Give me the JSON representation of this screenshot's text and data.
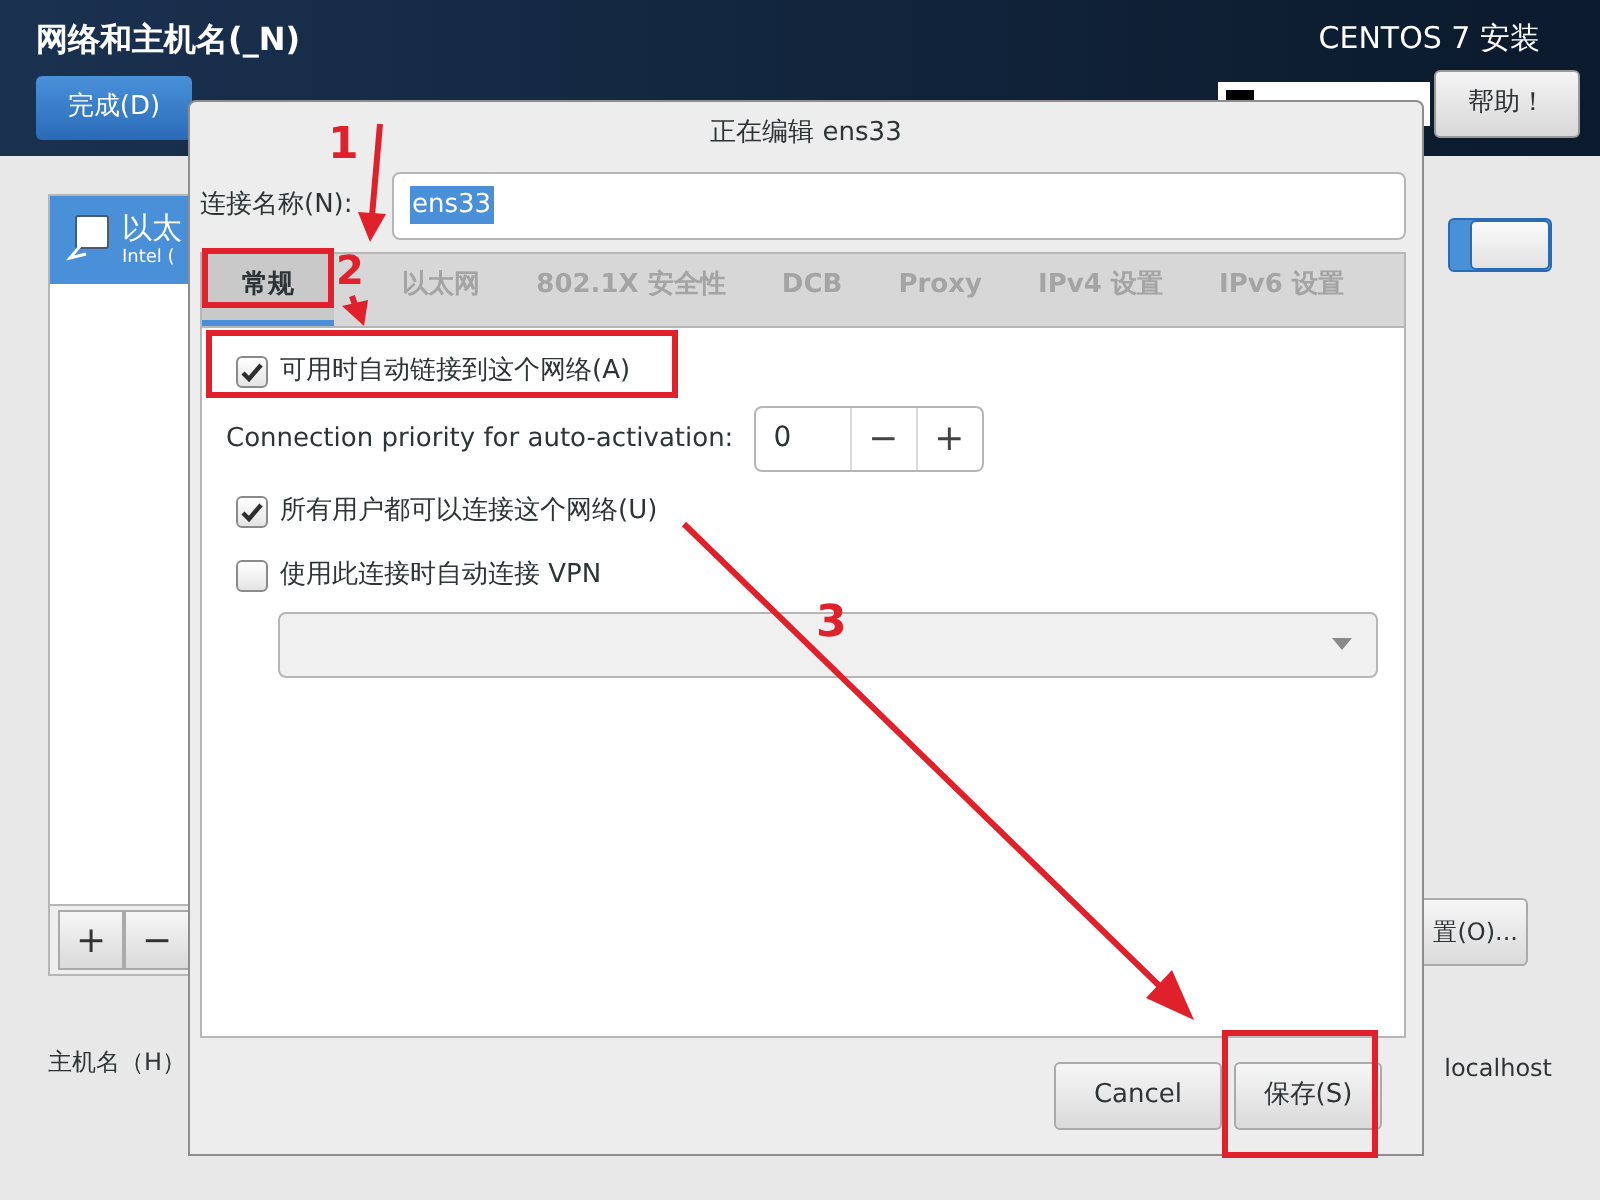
{
  "header": {
    "title": "网络和主机名(_N)",
    "done_button": "完成(D)",
    "product": "CENTOS 7 安装",
    "help_button": "帮助！"
  },
  "connections": [
    {
      "name": "以太",
      "detail": "Intel (",
      "selected": true
    }
  ],
  "switch": {
    "on": true
  },
  "list_buttons": [
    "+",
    "−"
  ],
  "configure_button": "置(O)...",
  "hostname": {
    "label": "主机名（H）",
    "value": "localhost"
  },
  "dialog": {
    "title": "正在编辑 ens33",
    "name_label": "连接名称(N):",
    "name_value": "ens33",
    "tabs": [
      {
        "label": "常规",
        "selected": true
      },
      {
        "label": "以太网",
        "selected": false
      },
      {
        "label": "802.1X 安全性",
        "selected": false
      },
      {
        "label": "DCB",
        "selected": false
      },
      {
        "label": "Proxy",
        "selected": false
      },
      {
        "label": "IPv4 设置",
        "selected": false
      },
      {
        "label": "IPv6 设置",
        "selected": false
      }
    ],
    "options": [
      {
        "kind": "checkbox",
        "label": "可用时自动链接到这个网络(A)",
        "checked": true
      },
      {
        "kind": "spin",
        "label": "Connection priority for auto-activation:",
        "value": "0",
        "minus": "−",
        "plus": "+"
      },
      {
        "kind": "checkbox",
        "label": "所有用户都可以连接这个网络(U)",
        "checked": true
      },
      {
        "kind": "checkbox",
        "label": "使用此连接时自动连接 VPN",
        "checked": false
      },
      {
        "kind": "dropdown"
      }
    ],
    "buttons": [
      "Cancel",
      "保存(S)"
    ]
  },
  "annotations": [
    "1",
    "2",
    "3"
  ]
}
